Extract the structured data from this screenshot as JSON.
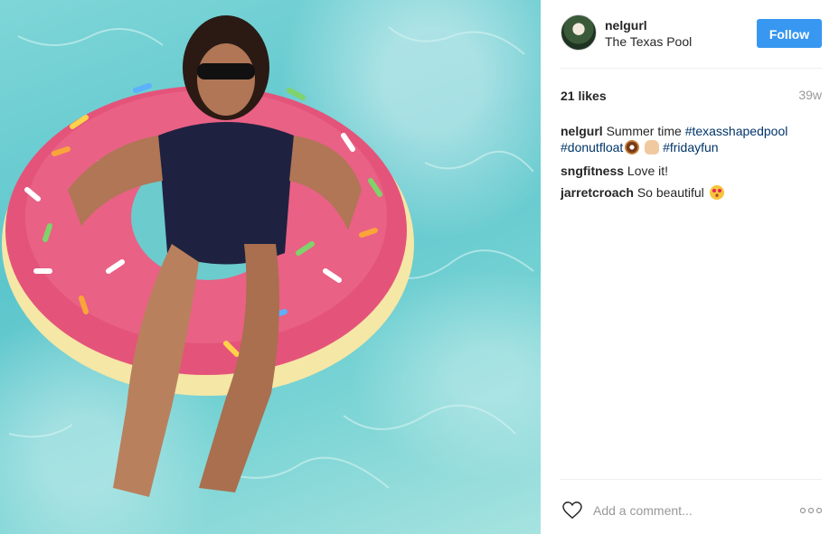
{
  "post": {
    "username": "nelgurl",
    "location": "The Texas Pool",
    "follow_label": "Follow",
    "likes": "21 likes",
    "age": "39w"
  },
  "caption": {
    "user": "nelgurl",
    "text": "Summer time",
    "tags": [
      "#texasshapedpool",
      "#donutfloat",
      "#fridayfun"
    ]
  },
  "comments": [
    {
      "user": "sngfitness",
      "text": "Love it!"
    },
    {
      "user": "jarretcroach",
      "text": "So beautiful"
    }
  ],
  "composer": {
    "placeholder": "Add a comment..."
  },
  "icons": [
    "heart-icon",
    "more-options-icon",
    "donut-emoji",
    "hand-emoji",
    "heart-eyes-emoji"
  ],
  "colors": {
    "accent": "#3897f0",
    "hashtag": "#003569",
    "muted": "#999999",
    "divider": "#efefef"
  }
}
